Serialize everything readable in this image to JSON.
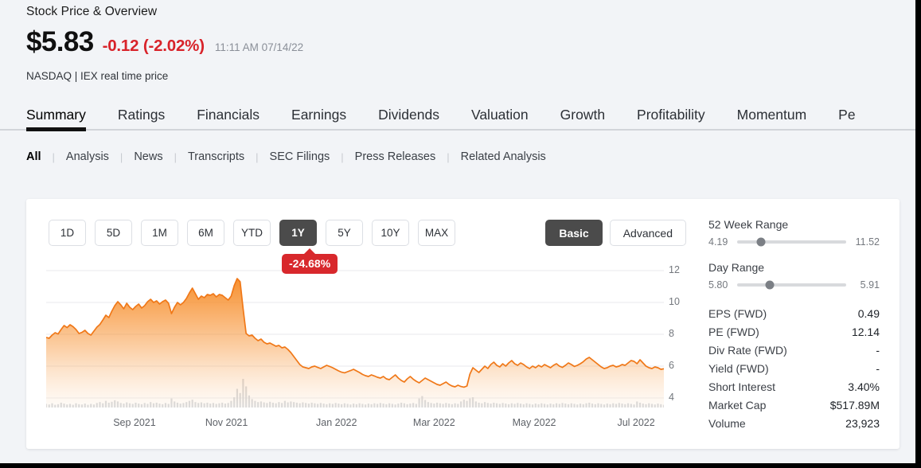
{
  "header": {
    "title": "Stock Price & Overview",
    "price": "$5.83",
    "change": "-0.12 (-2.02%)",
    "timestamp": "11:11 AM 07/14/22",
    "exchange": "NASDAQ | IEX real time price",
    "change_color": "#d8232a"
  },
  "tabs": [
    {
      "label": "Summary",
      "active": true
    },
    {
      "label": "Ratings",
      "active": false
    },
    {
      "label": "Financials",
      "active": false
    },
    {
      "label": "Earnings",
      "active": false
    },
    {
      "label": "Dividends",
      "active": false
    },
    {
      "label": "Valuation",
      "active": false
    },
    {
      "label": "Growth",
      "active": false
    },
    {
      "label": "Profitability",
      "active": false
    },
    {
      "label": "Momentum",
      "active": false
    },
    {
      "label": "Pe",
      "active": false
    }
  ],
  "subtabs": [
    {
      "label": "All",
      "active": true
    },
    {
      "label": "Analysis",
      "active": false
    },
    {
      "label": "News",
      "active": false
    },
    {
      "label": "Transcripts",
      "active": false
    },
    {
      "label": "SEC Filings",
      "active": false
    },
    {
      "label": "Press Releases",
      "active": false
    },
    {
      "label": "Related Analysis",
      "active": false
    }
  ],
  "ranges": [
    {
      "label": "1D",
      "selected": false
    },
    {
      "label": "5D",
      "selected": false
    },
    {
      "label": "1M",
      "selected": false
    },
    {
      "label": "6M",
      "selected": false
    },
    {
      "label": "YTD",
      "selected": false
    },
    {
      "label": "1Y",
      "selected": true
    },
    {
      "label": "5Y",
      "selected": false
    },
    {
      "label": "10Y",
      "selected": false
    },
    {
      "label": "MAX",
      "selected": false
    }
  ],
  "modes": [
    {
      "label": "Basic",
      "selected": true
    },
    {
      "label": "Advanced",
      "selected": false
    }
  ],
  "performance_badge": "-24.68%",
  "sidebar": {
    "week52": {
      "title": "52 Week Range",
      "low": "4.19",
      "high": "11.52",
      "position_pct": 22
    },
    "day": {
      "title": "Day Range",
      "low": "5.80",
      "high": "5.91",
      "position_pct": 30
    },
    "metrics": [
      {
        "key": "EPS (FWD)",
        "value": "0.49"
      },
      {
        "key": "PE (FWD)",
        "value": "12.14"
      },
      {
        "key": "Div Rate (FWD)",
        "value": "-"
      },
      {
        "key": "Yield (FWD)",
        "value": "-"
      },
      {
        "key": "Short Interest",
        "value": "3.40%"
      },
      {
        "key": "Market Cap",
        "value": "$517.89M"
      },
      {
        "key": "Volume",
        "value": "23,923"
      }
    ]
  },
  "chart_data": {
    "type": "area",
    "title": "",
    "xlabel": "",
    "ylabel": "",
    "ylim": [
      3.4,
      12.6
    ],
    "yticks": [
      12,
      10,
      8,
      6,
      4
    ],
    "xticks": [
      "Sep 2021",
      "Nov 2021",
      "Jan 2022",
      "Mar 2022",
      "May 2022",
      "Jul 2022"
    ],
    "xtick_pos_pct": [
      14.3,
      29.2,
      47.0,
      62.8,
      79.0,
      95.5
    ],
    "grid": true,
    "line_color": "#f07818",
    "fill_top": "#f79131",
    "fill_bottom": "#fdf0e2",
    "volume_color": "#c9ccd1",
    "period": "1Y",
    "change_pct": -24.68,
    "prices": [
      7.8,
      7.75,
      7.95,
      8.1,
      8.02,
      8.3,
      8.55,
      8.42,
      8.6,
      8.48,
      8.3,
      8.05,
      8.12,
      8.25,
      8.05,
      7.95,
      8.2,
      8.45,
      8.62,
      8.9,
      9.2,
      9.05,
      9.45,
      9.8,
      10.05,
      9.85,
      9.6,
      9.95,
      9.7,
      9.55,
      9.75,
      9.9,
      9.65,
      9.8,
      10.05,
      10.2,
      10.0,
      10.1,
      9.9,
      10.05,
      10.15,
      9.95,
      9.3,
      9.7,
      10.0,
      9.85,
      10.0,
      10.25,
      10.6,
      10.9,
      10.55,
      10.2,
      10.4,
      10.3,
      10.5,
      10.45,
      10.55,
      10.35,
      10.5,
      10.45,
      10.3,
      10.15,
      10.4,
      11.05,
      11.5,
      11.3,
      9.6,
      8.05,
      7.9,
      7.95,
      7.75,
      7.6,
      7.7,
      7.5,
      7.4,
      7.45,
      7.35,
      7.25,
      7.3,
      7.15,
      7.2,
      7.05,
      6.85,
      6.6,
      6.35,
      6.1,
      5.95,
      5.9,
      5.85,
      5.95,
      6.0,
      5.92,
      5.85,
      5.95,
      6.05,
      5.98,
      5.9,
      5.8,
      5.7,
      5.62,
      5.58,
      5.65,
      5.72,
      5.8,
      5.7,
      5.6,
      5.48,
      5.4,
      5.35,
      5.45,
      5.38,
      5.3,
      5.25,
      5.35,
      5.2,
      5.15,
      5.3,
      5.45,
      5.25,
      5.1,
      5.0,
      5.2,
      5.35,
      5.18,
      5.05,
      4.95,
      5.1,
      5.25,
      5.15,
      5.05,
      4.95,
      4.85,
      4.8,
      4.9,
      5.0,
      4.85,
      4.75,
      4.7,
      4.8,
      4.72,
      4.68,
      4.75,
      5.5,
      5.9,
      5.75,
      5.6,
      5.8,
      6.0,
      5.85,
      6.1,
      6.25,
      6.05,
      5.95,
      6.15,
      6.0,
      6.2,
      6.35,
      6.15,
      6.05,
      6.2,
      6.1,
      5.95,
      5.85,
      6.0,
      5.9,
      6.05,
      5.95,
      6.1,
      6.0,
      5.9,
      6.05,
      6.15,
      6.0,
      5.92,
      6.05,
      6.2,
      6.1,
      5.98,
      6.05,
      6.15,
      6.28,
      6.45,
      6.55,
      6.4,
      6.25,
      6.1,
      5.95,
      5.85,
      5.9,
      6.0,
      6.05,
      5.95,
      6.0,
      6.1,
      6.05,
      6.2,
      6.35,
      6.3,
      6.15,
      6.4,
      6.2,
      6.0,
      5.9,
      5.85,
      5.95,
      5.9,
      5.8,
      5.83
    ],
    "volumes": [
      12,
      10,
      14,
      9,
      11,
      16,
      13,
      10,
      12,
      9,
      14,
      11,
      10,
      13,
      9,
      12,
      10,
      15,
      18,
      14,
      22,
      16,
      19,
      24,
      20,
      15,
      13,
      17,
      14,
      12,
      16,
      13,
      11,
      15,
      12,
      18,
      14,
      16,
      13,
      11,
      15,
      12,
      30,
      20,
      16,
      13,
      15,
      18,
      22,
      26,
      18,
      15,
      17,
      14,
      16,
      13,
      15,
      12,
      14,
      16,
      13,
      15,
      22,
      34,
      62,
      48,
      95,
      70,
      40,
      28,
      22,
      18,
      20,
      17,
      15,
      19,
      16,
      14,
      18,
      15,
      22,
      17,
      20,
      18,
      16,
      14,
      17,
      15,
      13,
      16,
      14,
      12,
      15,
      13,
      11,
      14,
      12,
      15,
      13,
      11,
      14,
      12,
      10,
      13,
      11,
      14,
      12,
      10,
      13,
      11,
      14,
      12,
      15,
      13,
      11,
      14,
      12,
      10,
      13,
      16,
      14,
      11,
      13,
      15,
      12,
      30,
      38,
      25,
      18,
      15,
      13,
      16,
      14,
      12,
      15,
      13,
      11,
      14,
      12,
      20,
      26,
      22,
      30,
      34,
      20,
      16,
      14,
      18,
      15,
      13,
      16,
      14,
      12,
      15,
      13,
      11,
      14,
      12,
      15,
      13,
      11,
      14,
      12,
      10,
      13,
      11,
      14,
      12,
      10,
      13,
      11,
      14,
      12,
      15,
      13,
      11,
      14,
      12,
      10,
      13,
      11,
      14,
      16,
      13,
      11,
      14,
      12,
      10,
      13,
      11,
      14,
      12,
      15,
      13,
      11,
      14,
      12,
      10,
      20,
      16,
      13,
      11,
      14,
      12,
      10,
      13,
      11,
      9
    ]
  }
}
